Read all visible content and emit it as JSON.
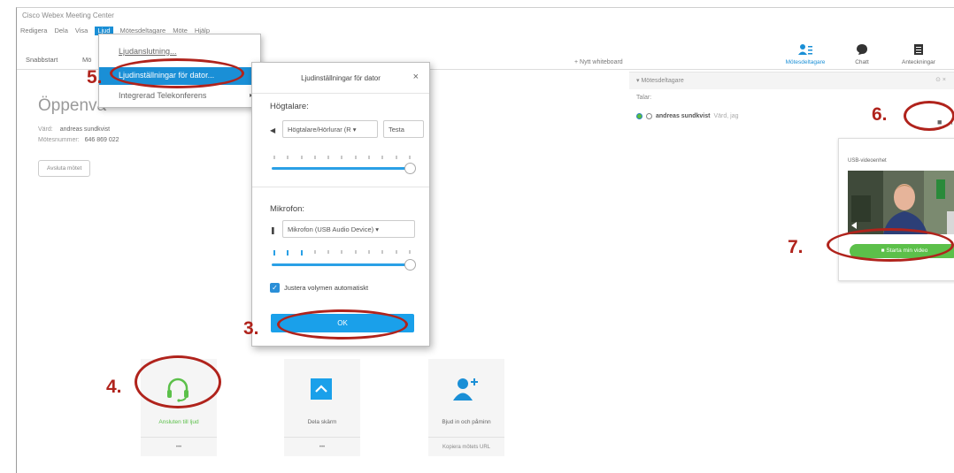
{
  "window": {
    "title": "Cisco Webex Meeting Center"
  },
  "menubar": {
    "items": [
      "Redigera",
      "Dela",
      "Visa",
      "Ljud",
      "Mötesdeltagare",
      "Möte",
      "Hjälp"
    ]
  },
  "tabs": {
    "snabbstart": "Snabbstart",
    "second": "Mö"
  },
  "toolbar": {
    "new_whiteboard": "Nytt whiteboard",
    "participants": "Mötesdeltagare",
    "chat": "Chatt",
    "notes": "Anteckningar"
  },
  "meeting": {
    "title": "Öppenvä",
    "host_label": "Värd:",
    "host_name": "andreas sundkvist",
    "number_label": "Mötesnummer:",
    "number_value": "646 869 022",
    "leave_button": "Avsluta mötet"
  },
  "participants_panel": {
    "header": "Mötesdeltagare",
    "speaker_label": "Talar:",
    "participant_name": "andreas sundkvist",
    "participant_role": "Värd, jag"
  },
  "video_panel": {
    "camera": "USB-videoenhet",
    "start_video": "Starta min video"
  },
  "tiles": {
    "audio_label": "Ansluten till ljud",
    "audio_foot": "•••",
    "share_label": "Dela skärm",
    "share_foot": "•••",
    "invite_label": "Bjud in och påminn",
    "invite_foot": "Kopiera mötets URL"
  },
  "dropdown": {
    "item1": "Ljudanslutning...",
    "item2": "Ljudinställningar för dator...",
    "item3": "Integrerad Telekonferens"
  },
  "dialog": {
    "title": "Ljudinställningar för dator",
    "speakers_label": "Högtalare:",
    "speaker_device": "Högtalare/Hörlurar (R",
    "test_button": "Testa",
    "mic_label": "Mikrofon:",
    "mic_device": "Mikrofon (USB Audio Device)",
    "auto_volume": "Justera volymen automatiskt",
    "ok_button": "OK"
  },
  "annotations": {
    "n3": "3.",
    "n4": "4.",
    "n5": "5.",
    "n6": "6.",
    "n7": "7."
  },
  "colors": {
    "accent": "#1a8fd6",
    "green": "#5cc04a",
    "annotation": "#b0231c"
  }
}
